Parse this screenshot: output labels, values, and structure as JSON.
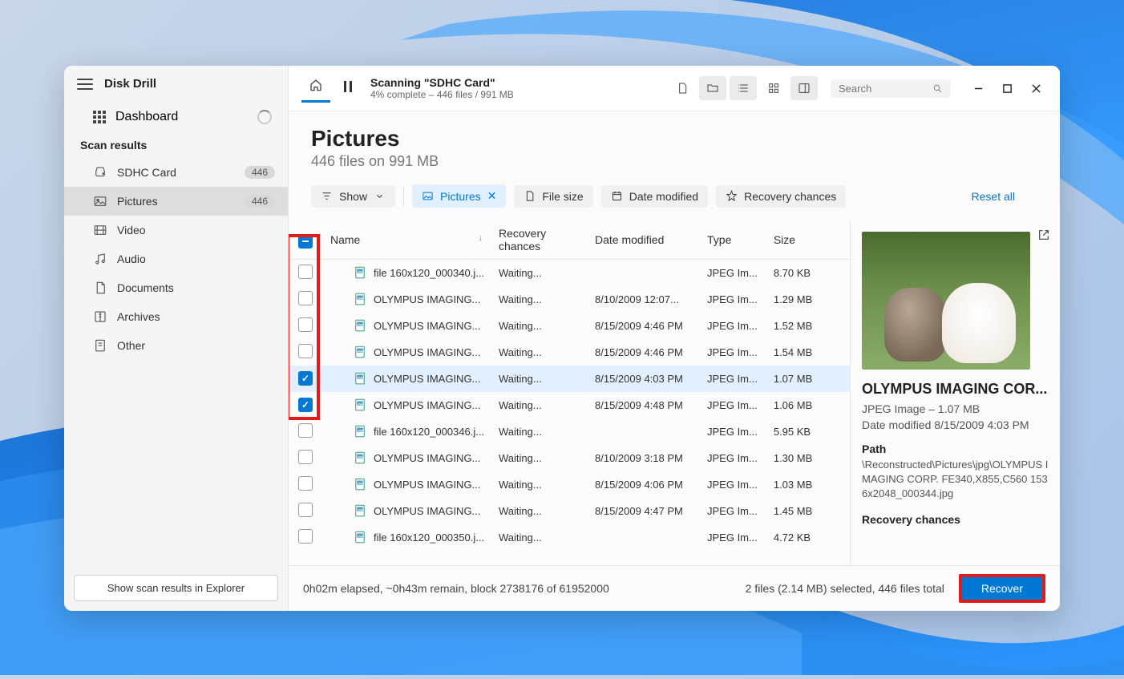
{
  "app_title": "Disk Drill",
  "sidebar": {
    "dashboard": "Dashboard",
    "section": "Scan results",
    "items": [
      {
        "label": "SDHC Card",
        "badge": "446"
      },
      {
        "label": "Pictures",
        "badge": "446"
      },
      {
        "label": "Video"
      },
      {
        "label": "Audio"
      },
      {
        "label": "Documents"
      },
      {
        "label": "Archives"
      },
      {
        "label": "Other"
      }
    ],
    "explorer_btn": "Show scan results in Explorer"
  },
  "topbar": {
    "scan_title": "Scanning \"SDHC Card\"",
    "scan_sub": "4% complete – 446 files / 991 MB",
    "search_placeholder": "Search"
  },
  "header": {
    "title": "Pictures",
    "subtitle": "446 files on 991 MB"
  },
  "filters": {
    "show": "Show",
    "pictures": "Pictures",
    "filesize": "File size",
    "date": "Date modified",
    "chances": "Recovery chances",
    "reset": "Reset all"
  },
  "cols": {
    "name": "Name",
    "rec": "Recovery chances",
    "date": "Date modified",
    "type": "Type",
    "size": "Size"
  },
  "files": [
    {
      "chk": "",
      "name": "file 160x120_000340.j...",
      "rec": "Waiting...",
      "date": "",
      "type": "JPEG Im...",
      "size": "8.70 KB"
    },
    {
      "chk": "",
      "name": "OLYMPUS IMAGING...",
      "rec": "Waiting...",
      "date": "8/10/2009 12:07...",
      "type": "JPEG Im...",
      "size": "1.29 MB"
    },
    {
      "chk": "",
      "name": "OLYMPUS IMAGING...",
      "rec": "Waiting...",
      "date": "8/15/2009 4:46 PM",
      "type": "JPEG Im...",
      "size": "1.52 MB"
    },
    {
      "chk": "",
      "name": "OLYMPUS IMAGING...",
      "rec": "Waiting...",
      "date": "8/15/2009 4:46 PM",
      "type": "JPEG Im...",
      "size": "1.54 MB"
    },
    {
      "chk": "checked",
      "name": "OLYMPUS IMAGING...",
      "rec": "Waiting...",
      "date": "8/15/2009 4:03 PM",
      "type": "JPEG Im...",
      "size": "1.07 MB",
      "sel": true
    },
    {
      "chk": "checked",
      "name": "OLYMPUS IMAGING...",
      "rec": "Waiting...",
      "date": "8/15/2009 4:48 PM",
      "type": "JPEG Im...",
      "size": "1.06 MB"
    },
    {
      "chk": "",
      "name": "file 160x120_000346.j...",
      "rec": "Waiting...",
      "date": "",
      "type": "JPEG Im...",
      "size": "5.95 KB"
    },
    {
      "chk": "",
      "name": "OLYMPUS IMAGING...",
      "rec": "Waiting...",
      "date": "8/10/2009 3:18 PM",
      "type": "JPEG Im...",
      "size": "1.30 MB"
    },
    {
      "chk": "",
      "name": "OLYMPUS IMAGING...",
      "rec": "Waiting...",
      "date": "8/15/2009 4:06 PM",
      "type": "JPEG Im...",
      "size": "1.03 MB"
    },
    {
      "chk": "",
      "name": "OLYMPUS IMAGING...",
      "rec": "Waiting...",
      "date": "8/15/2009 4:47 PM",
      "type": "JPEG Im...",
      "size": "1.45 MB"
    },
    {
      "chk": "",
      "name": "file 160x120_000350.j...",
      "rec": "Waiting...",
      "date": "",
      "type": "JPEG Im...",
      "size": "4.72 KB"
    }
  ],
  "preview": {
    "title": "OLYMPUS IMAGING COR...",
    "meta1": "JPEG Image – 1.07 MB",
    "meta2": "Date modified 8/15/2009 4:03 PM",
    "path_label": "Path",
    "path": "\\Reconstructed\\Pictures\\jpg\\OLYMPUS IMAGING CORP. FE340,X855,C560 1536x2048_000344.jpg",
    "chances_label": "Recovery chances"
  },
  "status": {
    "left": "0h02m elapsed, ~0h43m remain, block 2738176 of 61952000",
    "right": "2 files (2.14 MB) selected, 446 files total",
    "recover": "Recover"
  }
}
